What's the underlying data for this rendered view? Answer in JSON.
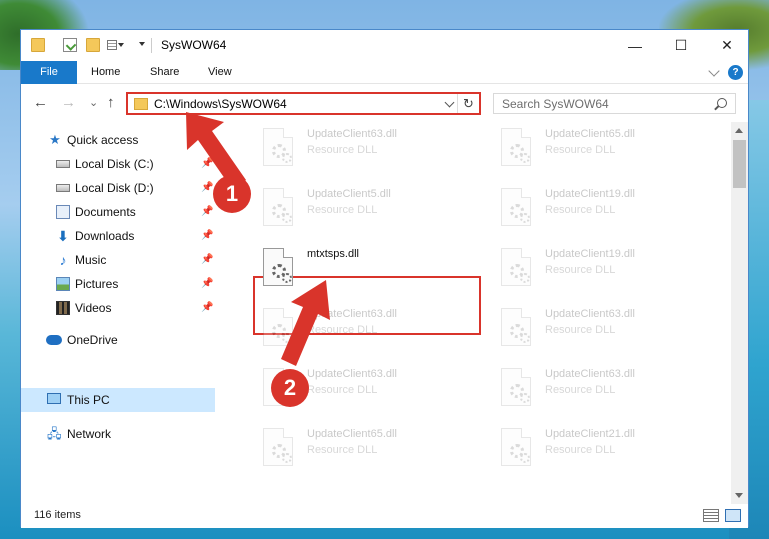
{
  "window": {
    "title": "SysWOW64",
    "controls": {
      "minimize": "—",
      "maximize": "☐",
      "close": "✕"
    }
  },
  "ribbon": {
    "tabs": [
      "File",
      "Home",
      "Share",
      "View"
    ],
    "help": "?"
  },
  "address": {
    "path": "C:\\Windows\\SysWOW64",
    "refresh": "↻"
  },
  "search": {
    "placeholder": "Search SysWOW64"
  },
  "nav": {
    "back": "←",
    "forward": "→",
    "recent": "⌄",
    "up": "↑"
  },
  "sidebar": {
    "items": [
      {
        "label": "Quick access",
        "icon": "star-icon"
      },
      {
        "label": "Local Disk (C:)",
        "icon": "disk-icon",
        "pinned": true
      },
      {
        "label": "Local Disk (D:)",
        "icon": "disk-icon",
        "pinned": true
      },
      {
        "label": "Documents",
        "icon": "documents-icon",
        "pinned": true
      },
      {
        "label": "Downloads",
        "icon": "download-icon",
        "pinned": true
      },
      {
        "label": "Music",
        "icon": "music-icon",
        "pinned": true
      },
      {
        "label": "Pictures",
        "icon": "pictures-icon",
        "pinned": true
      },
      {
        "label": "Videos",
        "icon": "video-icon",
        "pinned": true
      },
      {
        "label": "OneDrive",
        "icon": "cloud-icon"
      },
      {
        "label": "This PC",
        "icon": "computer-icon",
        "selected": true
      },
      {
        "label": "Network",
        "icon": "network-icon"
      }
    ],
    "pin_glyph": "📌"
  },
  "files": [
    {
      "name": "UpdateClient63.dll",
      "type": "Resource DLL"
    },
    {
      "name": "UpdateClient65.dll",
      "type": "Resource DLL"
    },
    {
      "name": "UpdateClient5.dll",
      "type": "Resource DLL"
    },
    {
      "name": "UpdateClient19.dll",
      "type": "Resource DLL"
    },
    {
      "name": "mtxtsps.dll",
      "type": "",
      "highlighted": true
    },
    {
      "name": "UpdateClient19.dll",
      "type": "Resource DLL"
    },
    {
      "name": "UpdateClient63.dll",
      "type": "Resource DLL"
    },
    {
      "name": "UpdateClient63.dll",
      "type": "Resource DLL"
    },
    {
      "name": "UpdateClient63.dll",
      "type": "Resource DLL"
    },
    {
      "name": "UpdateClient63.dll",
      "type": "Resource DLL"
    },
    {
      "name": "UpdateClient65.dll",
      "type": "Resource DLL"
    },
    {
      "name": "UpdateClient21.dll",
      "type": "Resource DLL"
    }
  ],
  "status": {
    "item_count": "116 items"
  },
  "annotations": {
    "step1": "1",
    "step2": "2",
    "color": "#d9342b"
  }
}
